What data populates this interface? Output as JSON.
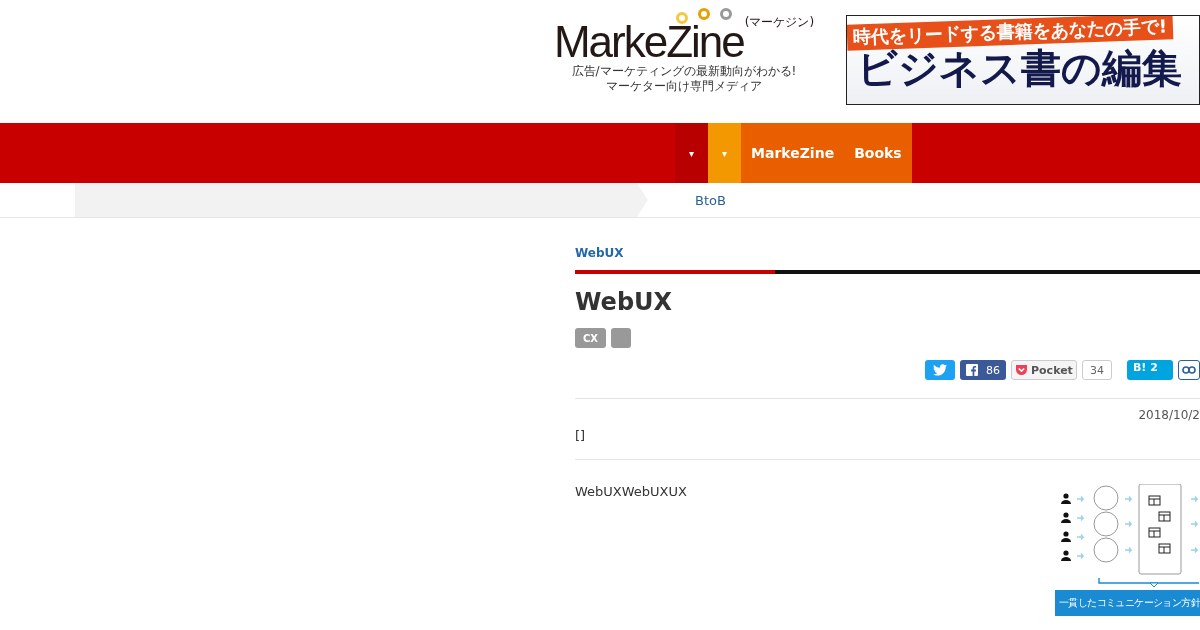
{
  "logo": {
    "name": "MarkeZine",
    "reading": "(マーケジン)",
    "tagline": [
      "広告/マーケティングの最新動向がわかる!",
      "マーケター向け専門メディア"
    ]
  },
  "ad": {
    "headline": "時代をリードする書籍をあなたの手で!",
    "title": "ビジネス書の編集"
  },
  "nav": {
    "items": [
      {
        "kind": "caret",
        "label": "▾",
        "color": "#b80000"
      },
      {
        "kind": "caret",
        "label": "▾",
        "color": "#f39800"
      },
      {
        "kind": "link",
        "label": "MarkeZine",
        "color": "#e95f00"
      },
      {
        "kind": "link",
        "label": "Books",
        "color": "#e95f00"
      }
    ]
  },
  "breadcrumb": {
    "items": [
      "BtoB"
    ]
  },
  "article": {
    "category": "WebUX",
    "title": "WebUX",
    "tags": [
      {
        "kind": "text",
        "label": "CX"
      },
      {
        "kind": "blank"
      }
    ],
    "share": [
      {
        "kind": "twitter"
      },
      {
        "kind": "facebook",
        "count": "86"
      },
      {
        "kind": "pocket",
        "label": "Pocket",
        "count": "34"
      },
      {
        "kind": "hatena",
        "label": "B!",
        "count": "2"
      },
      {
        "kind": "link"
      }
    ],
    "date": "2018/10/2",
    "lead": "[]",
    "body": "WebUXWebUXUX",
    "figure": {
      "caption": "一貫したコミュニケーション方針"
    }
  }
}
